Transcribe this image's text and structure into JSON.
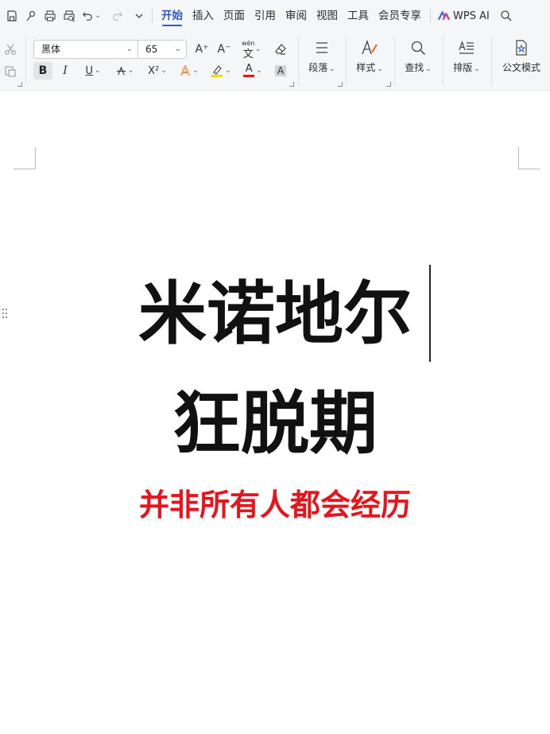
{
  "menubar": {
    "tabs": [
      {
        "label": "开始",
        "active": true
      },
      {
        "label": "插入"
      },
      {
        "label": "页面"
      },
      {
        "label": "引用"
      },
      {
        "label": "审阅"
      },
      {
        "label": "视图"
      },
      {
        "label": "工具"
      },
      {
        "label": "会员专享"
      }
    ],
    "wps_ai_label": "WPS AI",
    "quick_access_icons": [
      "save-icon",
      "pen-icon",
      "print-icon",
      "print-preview-icon",
      "undo-icon",
      "redo-icon",
      "more-chevron-icon"
    ]
  },
  "ribbon": {
    "font_name": "黑体",
    "font_size": "65",
    "groups": {
      "paragraph_label": "段落",
      "styles_label": "样式",
      "find_label": "查找",
      "layout_label": "排版",
      "official_doc_label": "公文模式"
    },
    "format_glyphs": {
      "bold": "B",
      "italic": "I",
      "underline": "U",
      "superscript": "X²",
      "font_color": "A",
      "char_shading": "A",
      "grow_font": "A⁺",
      "shrink_font": "A⁻",
      "phonetic": "wén"
    },
    "accent_color": "#2a5cc6",
    "highlight_color": "#f5d800",
    "font_color_bar": "#e8131b"
  },
  "document": {
    "title_line1": "米诺地尔",
    "title_line2": "狂脱期",
    "subtitle": "并非所有人都会经历",
    "subtitle_color": "#e8131b",
    "title_color": "#111111"
  }
}
